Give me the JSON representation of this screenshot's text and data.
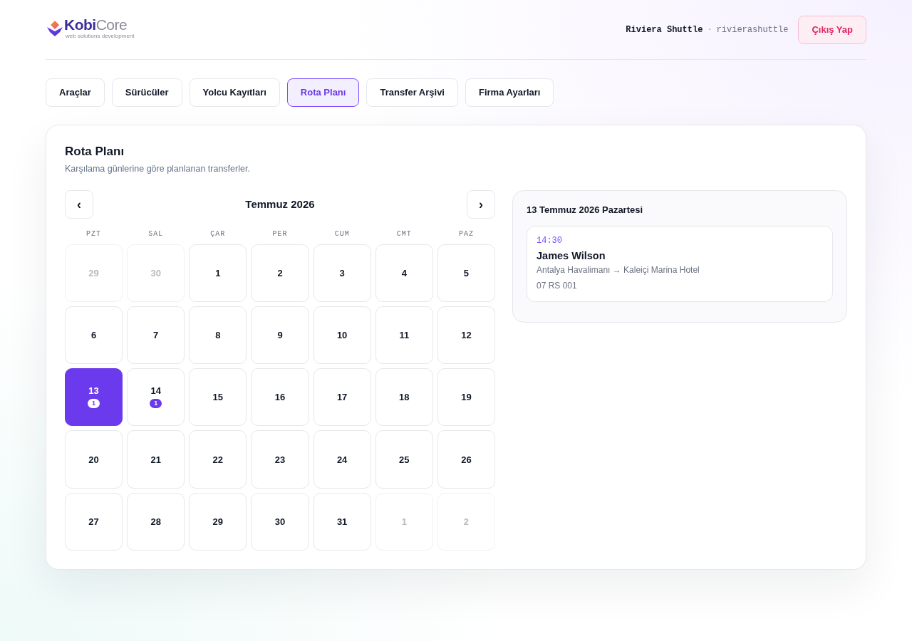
{
  "header": {
    "logo": {
      "primary": "Kobi",
      "secondary": "Core",
      "tagline": "web solutions development"
    },
    "user": {
      "company": "Riviera Shuttle",
      "separator": "·",
      "username": "rivierashuttle"
    },
    "logout_button": "Çıkış Yap"
  },
  "tabs": [
    {
      "label": "Araçlar",
      "selected": false
    },
    {
      "label": "Sürücüler",
      "selected": false
    },
    {
      "label": "Yolcu Kayıtları",
      "selected": false
    },
    {
      "label": "Rota Planı",
      "selected": true
    },
    {
      "label": "Transfer Arşivi",
      "selected": false
    },
    {
      "label": "Firma Ayarları",
      "selected": false
    }
  ],
  "panel": {
    "title": "Rota Planı",
    "subtitle": "Karşılama günlerine göre planlanan transferler."
  },
  "calendar": {
    "prev_button": "‹",
    "month": "Temmuz 2026",
    "next_button": "›",
    "weekdays": [
      "PZT",
      "SAL",
      "ÇAR",
      "PER",
      "CUM",
      "CMT",
      "PAZ"
    ],
    "days": [
      {
        "label": "29",
        "in_month": false,
        "selected": false
      },
      {
        "label": "30",
        "in_month": false,
        "selected": false
      },
      {
        "label": "1",
        "in_month": true,
        "selected": false
      },
      {
        "label": "2",
        "in_month": true,
        "selected": false
      },
      {
        "label": "3",
        "in_month": true,
        "selected": false
      },
      {
        "label": "4",
        "in_month": true,
        "selected": false
      },
      {
        "label": "5",
        "in_month": true,
        "selected": false
      },
      {
        "label": "6",
        "in_month": true,
        "selected": false
      },
      {
        "label": "7",
        "in_month": true,
        "selected": false
      },
      {
        "label": "8",
        "in_month": true,
        "selected": false
      },
      {
        "label": "9",
        "in_month": true,
        "selected": false
      },
      {
        "label": "10",
        "in_month": true,
        "selected": false
      },
      {
        "label": "11",
        "in_month": true,
        "selected": false
      },
      {
        "label": "12",
        "in_month": true,
        "selected": false
      },
      {
        "label": "13",
        "in_month": true,
        "selected": true,
        "count": "1"
      },
      {
        "label": "14",
        "in_month": true,
        "selected": false,
        "count": "1"
      },
      {
        "label": "15",
        "in_month": true,
        "selected": false
      },
      {
        "label": "16",
        "in_month": true,
        "selected": false
      },
      {
        "label": "17",
        "in_month": true,
        "selected": false
      },
      {
        "label": "18",
        "in_month": true,
        "selected": false
      },
      {
        "label": "19",
        "in_month": true,
        "selected": false
      },
      {
        "label": "20",
        "in_month": true,
        "selected": false
      },
      {
        "label": "21",
        "in_month": true,
        "selected": false
      },
      {
        "label": "22",
        "in_month": true,
        "selected": false
      },
      {
        "label": "23",
        "in_month": true,
        "selected": false
      },
      {
        "label": "24",
        "in_month": true,
        "selected": false
      },
      {
        "label": "25",
        "in_month": true,
        "selected": false
      },
      {
        "label": "26",
        "in_month": true,
        "selected": false
      },
      {
        "label": "27",
        "in_month": true,
        "selected": false
      },
      {
        "label": "28",
        "in_month": true,
        "selected": false
      },
      {
        "label": "29",
        "in_month": true,
        "selected": false
      },
      {
        "label": "30",
        "in_month": true,
        "selected": false
      },
      {
        "label": "31",
        "in_month": true,
        "selected": false
      },
      {
        "label": "1",
        "in_month": false,
        "selected": false
      },
      {
        "label": "2",
        "in_month": false,
        "selected": false
      }
    ]
  },
  "day_detail": {
    "title": "13 Temmuz 2026 Pazartesi",
    "transfers": [
      {
        "time": "14:30",
        "passenger": "James Wilson",
        "route": "Antalya Havalimanı → Kaleiçi Marina Hotel",
        "plate": "07 RS 001"
      }
    ]
  }
}
